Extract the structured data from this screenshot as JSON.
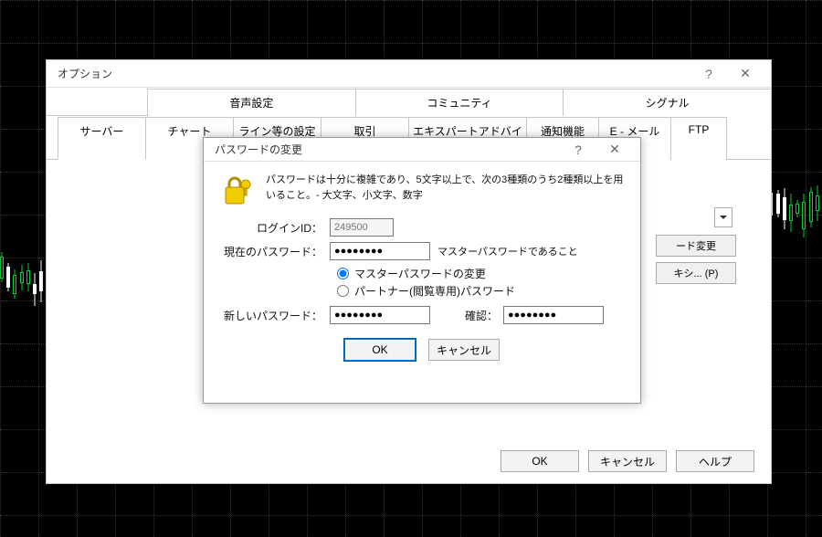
{
  "options_window": {
    "title": "オプション",
    "tabs_upper": [
      "音声設定",
      "コミュニティ",
      "シグナル"
    ],
    "tabs_lower": [
      "サーバー",
      "チャート",
      "ライン等の設定",
      "取引",
      "エキスパートアドバイザ",
      "通知機能",
      "E - メール",
      "FTP"
    ],
    "active_tab": "サーバー",
    "side_buttons": {
      "change_pw": "ード変更",
      "proxy": "キシ... (P)"
    },
    "buttons": {
      "ok": "OK",
      "cancel": "キャンセル",
      "help": "ヘルプ"
    }
  },
  "dialog": {
    "title": "パスワードの変更",
    "info": "パスワードは十分に複雑であり、5文字以上で、次の3種類のうち2種類以上を用いること。- 大文字、小文字、数字",
    "login_label": "ログインID：",
    "login_value": "249500",
    "current_pw_label": "現在のパスワード：",
    "current_pw_value": "●●●●●●●●",
    "current_pw_note": "マスターパスワードであること",
    "radio_master": "マスターパスワードの変更",
    "radio_partner": "パートナー(閲覧専用)パスワード",
    "new_pw_label": "新しいパスワード：",
    "new_pw_value": "●●●●●●●●",
    "confirm_label": "確認：",
    "confirm_value": "●●●●●●●●",
    "buttons": {
      "ok": "OK",
      "cancel": "キャンセル"
    }
  }
}
